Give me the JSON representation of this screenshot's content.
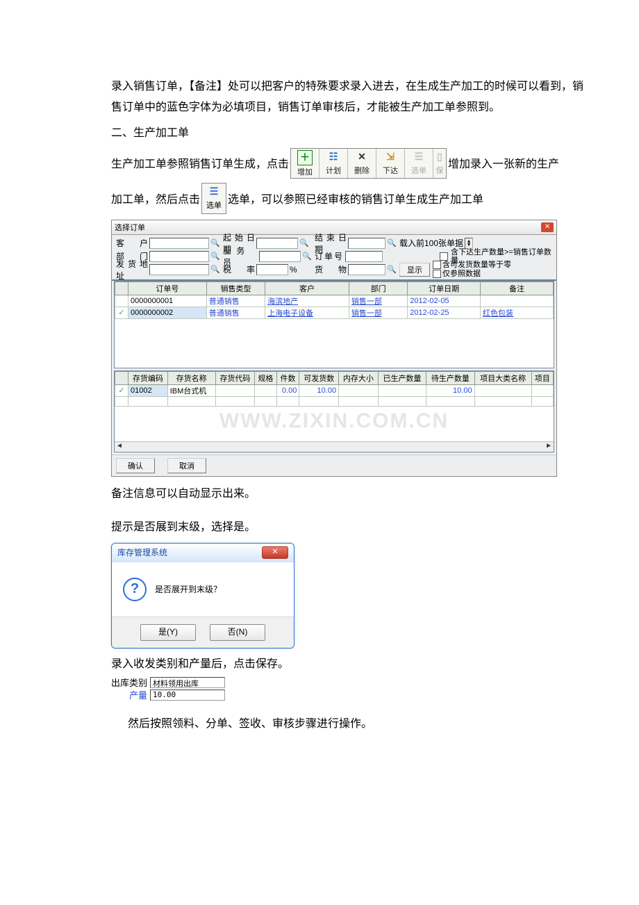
{
  "intro": {
    "p1": "录入销售订单，【备注】处可以把客户的特殊要求录入进去，在生成生产加工的时候可以看到，销售订单中的蓝色字体为必填项目，销售订单审核后，才能被生产加工单参照到。",
    "heading2": "二、生产加工单",
    "p2a": "生产加工单参照销售订单生成，点击",
    "p2b": "增加录入一张新的生产",
    "p3a": "加工单，然后点击",
    "p3b": "选单，可以参照已经审核的销售订单生成生产加工单"
  },
  "toolbar": {
    "add": "增加",
    "plan": "计划",
    "del": "删除",
    "issue": "下达",
    "select": "选单",
    "save": "保"
  },
  "mini_select": "选单",
  "dlg": {
    "title": "选择订单",
    "labels": {
      "customer": "客    户",
      "dept": "部    门",
      "addr": "发货地址",
      "start": "起始日期",
      "sales": "业 务 员",
      "rate": "税    率",
      "ratepct": "%",
      "end": "结束日期",
      "orderno": "订单号",
      "goods": "货    物",
      "load": "载入前100张单据",
      "show": "显示",
      "chk1": "含下达生产数量>=销售订单数量",
      "chk2": "含可发货数量等于零",
      "chk3": "仅参照数据"
    },
    "headers1": [
      "订单号",
      "销售类型",
      "客户",
      "部门",
      "订单日期",
      "备注"
    ],
    "rows1": [
      {
        "no": "0000000001",
        "type": "普通销售",
        "cust": "海滨地产",
        "dept": "销售一部",
        "date": "2012-02-05",
        "remark": ""
      },
      {
        "no": "0000000002",
        "type": "普通销售",
        "cust": "上海电子设备",
        "dept": "销售一部",
        "date": "2012-02-25",
        "remark": "红色包装"
      }
    ],
    "headers2": [
      "",
      "存货编码",
      "存货名称",
      "存货代码",
      "规格",
      "件数",
      "可发货数",
      "内存大小",
      "已生产数量",
      "待生产数量",
      "项目大类名称",
      "项目"
    ],
    "rows2": [
      {
        "mark": "✓",
        "code": "01002",
        "name": "IBM台式机",
        "sku": "",
        "spec": "",
        "qty": "0.00",
        "ship": "10.00",
        "mem": "",
        "made": "",
        "tomake": "10.00",
        "cat": "",
        "proj": ""
      }
    ],
    "ok": "确认",
    "cancel": "取消"
  },
  "watermark": "WWW.ZIXIN.COM.CN",
  "after_dlg": "备注信息可以自动显示出来。",
  "expand_hint": "提示是否展到末级，选择是。",
  "msgbox": {
    "title": "库存管理系统",
    "text": "是否展开到末级？",
    "yes": "是(Y)",
    "no": "否(N)"
  },
  "save_hint": "录入收发类别和产量后，点击保存。",
  "outtype": {
    "label": "出库类别",
    "value": "材料领用出库"
  },
  "output": {
    "label": "产量",
    "value": "10.00"
  },
  "final": "然后按照领料、分单、签收、审核步骤进行操作。"
}
